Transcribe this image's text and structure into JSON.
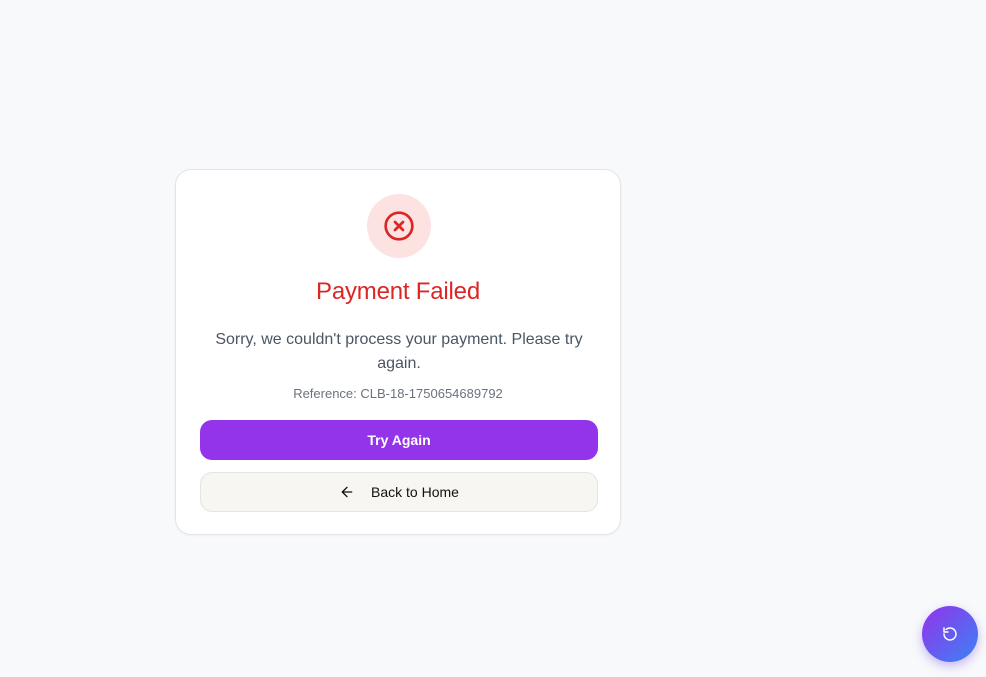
{
  "card": {
    "status_icon": "x-circle-icon",
    "title": "Payment Failed",
    "message": "Sorry, we couldn't process your payment. Please try again.",
    "reference_label": "Reference: CLB-18-1750654689792"
  },
  "actions": {
    "try_again_label": "Try Again",
    "back_home_label": "Back to Home",
    "back_home_icon": "arrow-left-icon"
  },
  "fab": {
    "icon": "refresh-icon"
  },
  "colors": {
    "error": "#dc2626",
    "error_bg": "#fde2e2",
    "primary": "#9333ea",
    "fab_gradient_end": "#3b82f6"
  }
}
